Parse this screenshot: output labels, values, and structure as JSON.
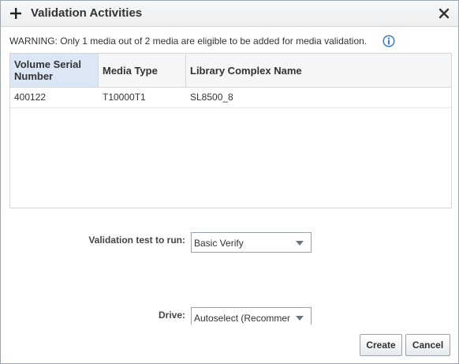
{
  "dialog": {
    "title": "Validation Activities",
    "warning": "WARNING: Only 1 media out of 2 media are eligible to be added for media validation."
  },
  "table": {
    "headers": [
      "Volume Serial Number",
      "Media Type",
      "Library Complex Name"
    ],
    "rows": [
      [
        "400122",
        "T10000T1",
        "SL8500_8"
      ]
    ]
  },
  "form": {
    "validation_label": "Validation test to run:",
    "validation_value": "Basic Verify",
    "drive_label": "Drive:",
    "drive_value": "Autoselect (Recommended)"
  },
  "buttons": {
    "create": "Create",
    "cancel": "Cancel"
  },
  "colors": {
    "accent": "#dce7f5",
    "info_icon": "#3a7bd5"
  }
}
